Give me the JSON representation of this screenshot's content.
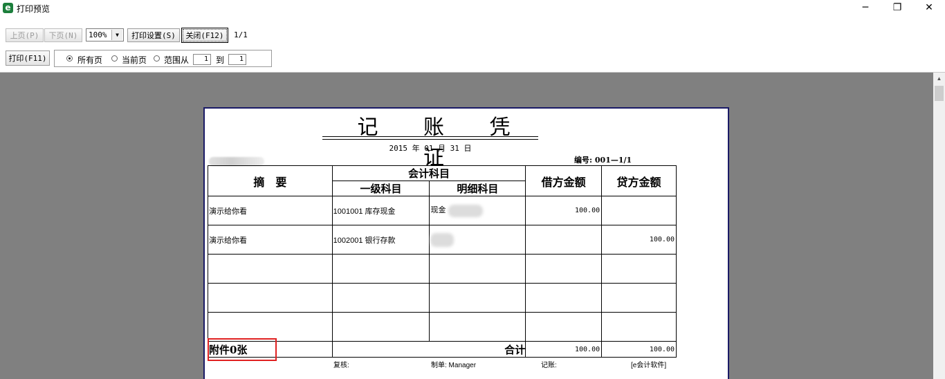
{
  "window": {
    "title": "打印预览",
    "icon_name": "app-e-icon",
    "icon_glyph": "e",
    "minimize": "─",
    "restore": "❐",
    "close": "✕"
  },
  "toolbar": {
    "prev_page": "上页(P)",
    "next_page": "下页(N)",
    "zoom_value": "100%",
    "print_settings": "打印设置(S)",
    "close_preview": "关闭(F12)",
    "page_count": "1/1",
    "print": "打印(F11)",
    "range": {
      "all_pages": "所有页",
      "current_page": "当前页",
      "range_from": "范围从",
      "from_value": "1",
      "to": "到",
      "to_value": "1",
      "selected": "all_pages"
    }
  },
  "voucher": {
    "title": "记 账 凭 证",
    "date": "2015 年 01 月 31 日",
    "number": "编号: 001—1/1",
    "headers": {
      "summary": "摘　要",
      "account": "会计科目",
      "level1": "一级科目",
      "detail": "明细科目",
      "debit": "借方金额",
      "credit": "贷方金额"
    },
    "rows": [
      {
        "summary": "演示给你看",
        "level1": "1001001 库存现金",
        "detail": "现金 ",
        "debit": "100.00",
        "credit": ""
      },
      {
        "summary": "演示给你看",
        "level1": "1002001 银行存款",
        "detail": "",
        "debit": "",
        "credit": "100.00"
      },
      {
        "summary": "",
        "level1": "",
        "detail": "",
        "debit": "",
        "credit": ""
      },
      {
        "summary": "",
        "level1": "",
        "detail": "",
        "debit": "",
        "credit": ""
      },
      {
        "summary": "",
        "level1": "",
        "detail": "",
        "debit": "",
        "credit": ""
      }
    ],
    "attachments": "附件0张",
    "total_label": "合计",
    "total_debit": "100.00",
    "total_credit": "100.00",
    "reviewer": "复核:",
    "maker": "制单: Manager",
    "bookkeeper": "记账:",
    "software": "[e会计软件]"
  },
  "colors": {
    "preview_bg": "#808080",
    "paper_border": "#1a1a66",
    "highlight": "#e02020"
  }
}
